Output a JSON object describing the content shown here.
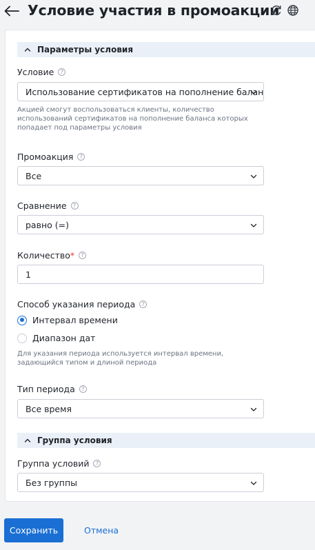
{
  "header": {
    "title": "Условие участия в промоакции",
    "back_icon": "arrow-left-icon",
    "refresh_icon": "refresh-icon",
    "globe_icon": "globe-icon"
  },
  "sections": {
    "params": {
      "title": "Параметры условия"
    },
    "group": {
      "title": "Группа условия"
    }
  },
  "fields": {
    "condition": {
      "label": "Условие",
      "value": "Использование сертификатов на пополнение баланса",
      "hint": "Акцией смогут воспользоваться клиенты, количество использований сертификатов на пополнение баланса которых попадает под параметры условия"
    },
    "promo": {
      "label": "Промоакция",
      "value": "Все"
    },
    "comparison": {
      "label": "Сравнение",
      "value": "равно (=)"
    },
    "quantity": {
      "label": "Количество",
      "required_mark": "*",
      "value": "1"
    },
    "period_method": {
      "label": "Способ указания периода",
      "options": [
        {
          "label": "Интервал времени",
          "selected": true
        },
        {
          "label": "Диапазон дат",
          "selected": false
        }
      ],
      "hint": "Для указания периода используется интервал времени, задающийся типом и длиной периода"
    },
    "period_type": {
      "label": "Тип периода",
      "value": "Все время"
    },
    "condition_group": {
      "label": "Группа условий",
      "value": "Без группы"
    }
  },
  "help_glyph": "?",
  "actions": {
    "save": "Сохранить",
    "cancel": "Отмена"
  },
  "colors": {
    "accent": "#1a6fd4",
    "section_bg": "#e9f0f8",
    "required": "#e8362c"
  }
}
